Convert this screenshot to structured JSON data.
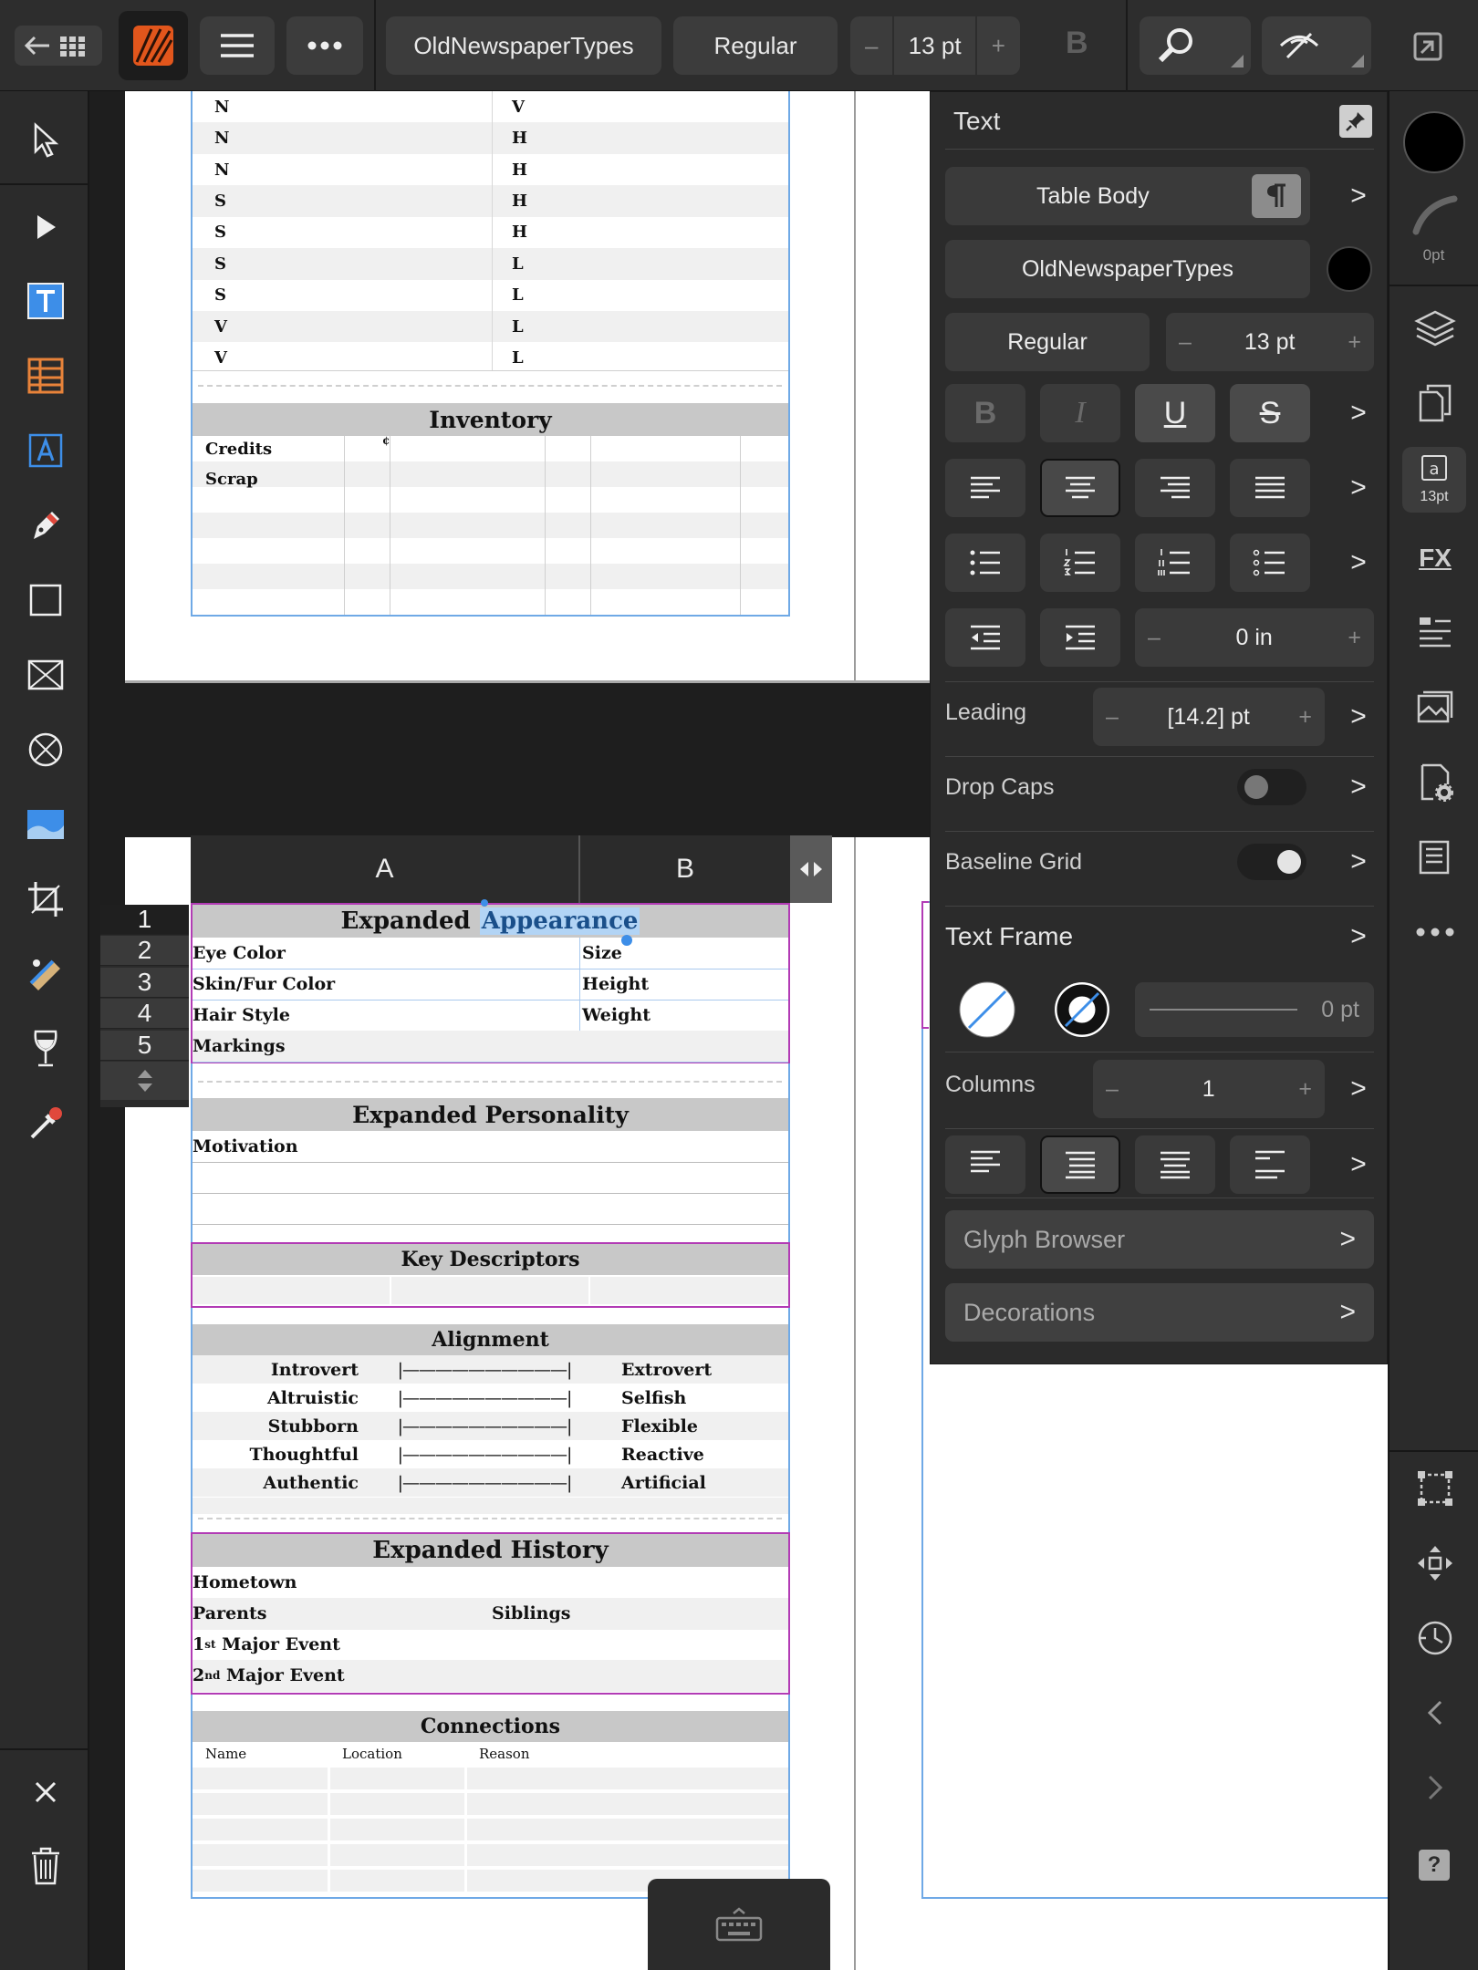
{
  "toolbar": {
    "font_name": "OldNewspaperTypes",
    "font_style": "Regular",
    "font_size": "13 pt",
    "minus": "–",
    "plus": "+",
    "bold": "B"
  },
  "top_page": {
    "rows": [
      {
        "a": "N",
        "b": "V"
      },
      {
        "a": "N",
        "b": "H"
      },
      {
        "a": "N",
        "b": "H"
      },
      {
        "a": "S",
        "b": "H"
      },
      {
        "a": "S",
        "b": "H"
      },
      {
        "a": "S",
        "b": "L"
      },
      {
        "a": "S",
        "b": "L"
      },
      {
        "a": "V",
        "b": "L"
      },
      {
        "a": "V",
        "b": "L"
      }
    ],
    "inventory_title": "Inventory",
    "inventory_rows": [
      "Credits",
      "Scrap"
    ],
    "cent_sign": "¢"
  },
  "table_editor": {
    "col_a": "A",
    "col_b": "B",
    "row_numbers": [
      "1",
      "2",
      "3",
      "4",
      "5"
    ]
  },
  "bottom_page": {
    "appearance_title_1": "Expanded",
    "appearance_title_2": "Appearance",
    "appearance_rows": [
      {
        "a": "Eye Color",
        "b": "Size"
      },
      {
        "a": "Skin/Fur Color",
        "b": "Height"
      },
      {
        "a": "Hair Style",
        "b": "Weight"
      },
      {
        "a": "Markings",
        "b": ""
      }
    ],
    "personality_title": "Expanded Personality",
    "motivation": "Motivation",
    "key_descriptors": "Key Descriptors",
    "alignment_title": "Alignment",
    "alignment_scale": "|——————————|",
    "alignment_rows": [
      {
        "left": "Introvert",
        "right": "Extrovert"
      },
      {
        "left": "Altruistic",
        "right": "Selfish"
      },
      {
        "left": "Stubborn",
        "right": "Flexible"
      },
      {
        "left": "Thoughtful",
        "right": "Reactive"
      },
      {
        "left": "Authentic",
        "right": "Artificial"
      }
    ],
    "history_title": "Expanded History",
    "hometown": "Hometown",
    "parents": "Parents",
    "siblings": "Siblings",
    "event1_num": "1",
    "event1_sup": "st",
    "event1_text": " Major Event",
    "event2_num": "2",
    "event2_sup": "nd",
    "event2_text": " Major Event",
    "connections_title": "Connections",
    "conn_headers": [
      "Name",
      "Location",
      "Reason"
    ]
  },
  "panel": {
    "title": "Text",
    "paragraph_style": "Table Body",
    "font": "OldNewspaperTypes",
    "style": "Regular",
    "size": "13 pt",
    "bold": "B",
    "italic": "I",
    "underline": "U",
    "strike": "S",
    "indent_value": "0 in",
    "leading_label": "Leading",
    "leading_value": "[14.2] pt",
    "dropcaps_label": "Drop Caps",
    "baseline_label": "Baseline Grid",
    "textframe_label": "Text Frame",
    "stroke_value": "0 pt",
    "columns_label": "Columns",
    "columns_value": "1",
    "glyph_browser": "Glyph Browser",
    "decorations": "Decorations",
    "minus": "–",
    "plus": "+",
    "chevron": ">"
  },
  "rightstrip": {
    "stroke_width": "0pt",
    "text_badge": "13pt",
    "fx": "FX",
    "help": "?"
  },
  "colors": {
    "accent_blue": "#3d8ee8",
    "selection_magenta": "#b23bb5",
    "brand_orange": "#e2561c"
  }
}
